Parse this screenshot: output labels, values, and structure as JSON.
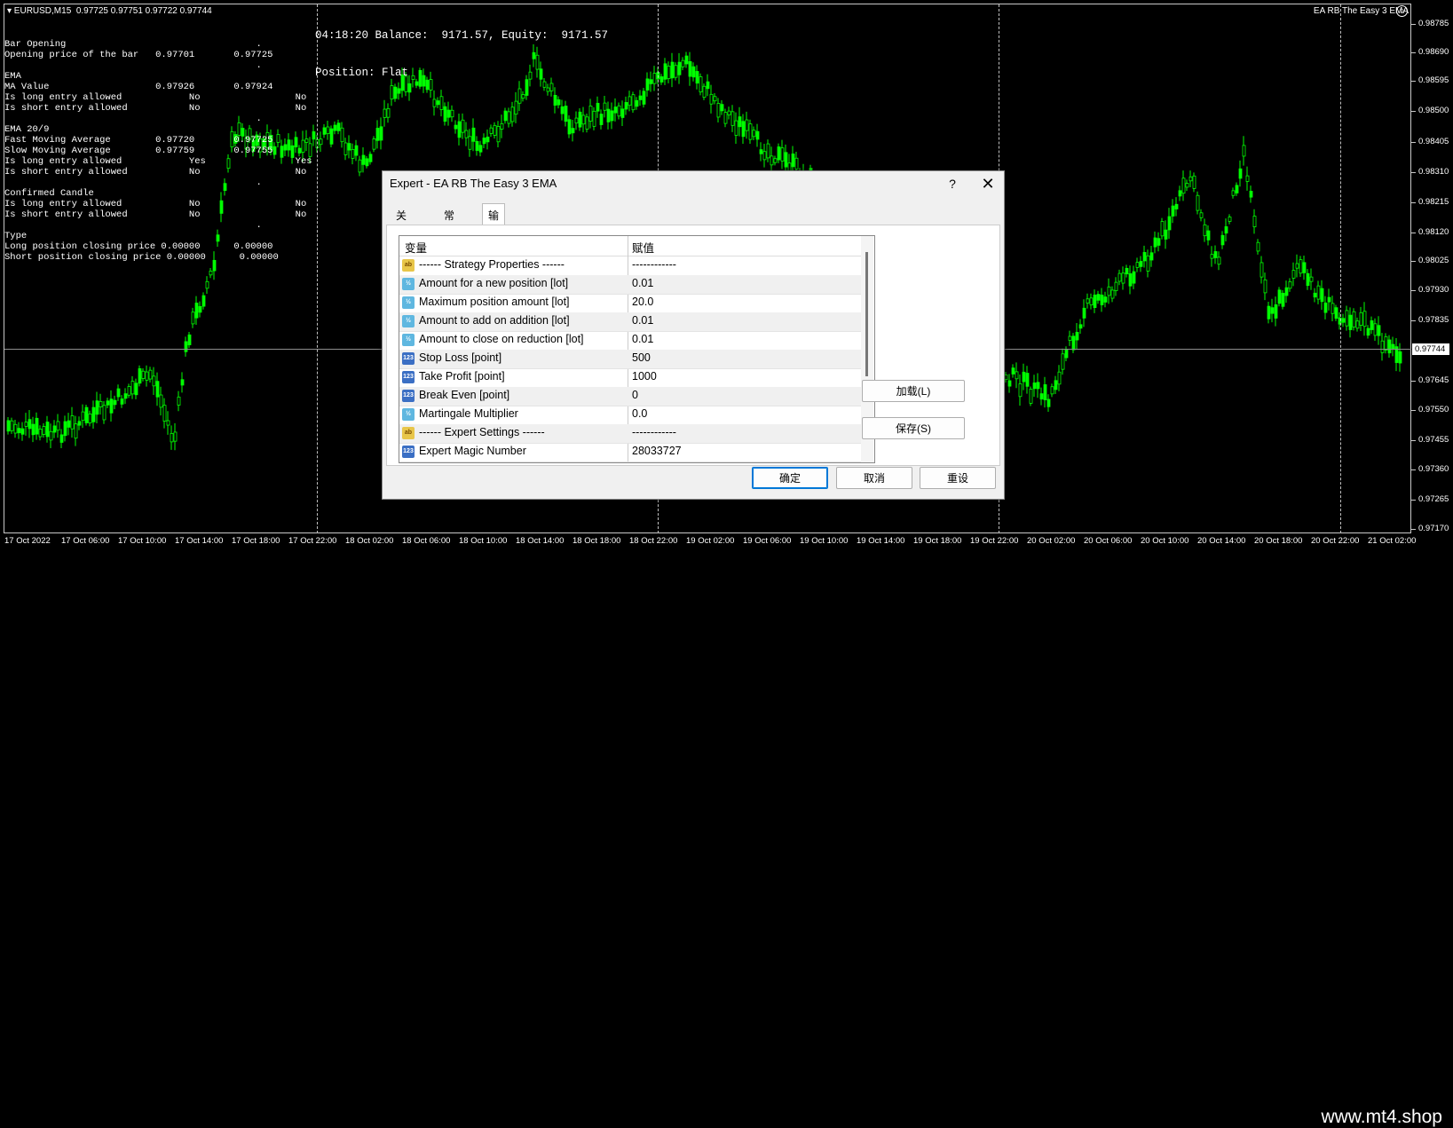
{
  "chart": {
    "symbol_info": "▾ EURUSD,M15  0.97725 0.97751 0.97722 0.97744",
    "balance_line": "04:18:20 Balance:  9171.57, Equity:  9171.57",
    "position_line": "Position: Flat",
    "ea_name": "EA RB The Easy 3 EMA",
    "current_price": "0.97744",
    "price_labels": [
      "0.98785",
      "0.98690",
      "0.98595",
      "0.98500",
      "0.98405",
      "0.98310",
      "0.98215",
      "0.98120",
      "0.98025",
      "0.97930",
      "0.97835",
      "0.97645",
      "0.97550",
      "0.97455",
      "0.97360",
      "0.97265",
      "0.97170"
    ],
    "time_labels": [
      "17 Oct 2022",
      "17 Oct 06:00",
      "17 Oct 10:00",
      "17 Oct 14:00",
      "17 Oct 18:00",
      "17 Oct 22:00",
      "18 Oct 02:00",
      "18 Oct 06:00",
      "18 Oct 10:00",
      "18 Oct 14:00",
      "18 Oct 18:00",
      "18 Oct 22:00",
      "19 Oct 02:00",
      "19 Oct 06:00",
      "19 Oct 10:00",
      "19 Oct 14:00",
      "19 Oct 18:00",
      "19 Oct 22:00",
      "20 Oct 02:00",
      "20 Oct 06:00",
      "20 Oct 10:00",
      "20 Oct 14:00",
      "20 Oct 18:00",
      "20 Oct 22:00",
      "21 Oct 02:00"
    ],
    "candle_color": "#00ff00",
    "info_lines": [
      "Bar Opening                                  .",
      "Opening price of the bar   0.97701       0.97725",
      "                                             .",
      "EMA",
      "MA Value                   0.97926       0.97924",
      "Is long entry allowed            No                 No",
      "Is short entry allowed           No                 No",
      "                                             .",
      "EMA 20/9",
      "Fast Moving Average        0.97720       0.97725",
      "Slow Moving Average        0.97759       0.97755",
      "Is long entry allowed            Yes                Yes",
      "Is short entry allowed           No                 No",
      "                                             .",
      "Confirmed Candle",
      "Is long entry allowed            No                 No",
      "Is short entry allowed           No                 No",
      "                                             .",
      "Type",
      "Long position closing price 0.00000      0.00000",
      "Short position closing price 0.00000      0.00000"
    ]
  },
  "dialog": {
    "title": "Expert - EA RB The Easy 3 EMA",
    "help_label": "?",
    "close_label": "✕",
    "tabs": [
      "关于",
      "常用",
      "输入参数"
    ],
    "active_tab": "输入参数",
    "columns": [
      "变量",
      "赋值"
    ],
    "params": [
      {
        "icon": "ab",
        "name": "------ Strategy Properties ------",
        "value": "------------"
      },
      {
        "icon": "v2",
        "name": "Amount for a new position [lot]",
        "value": "0.01"
      },
      {
        "icon": "v2",
        "name": "Maximum position amount [lot]",
        "value": "20.0"
      },
      {
        "icon": "v2",
        "name": "Amount to add on addition [lot]",
        "value": "0.01"
      },
      {
        "icon": "v2",
        "name": "Amount to close on reduction [lot]",
        "value": "0.01"
      },
      {
        "icon": "123",
        "name": "Stop Loss [point]",
        "value": "500"
      },
      {
        "icon": "123",
        "name": "Take Profit [point]",
        "value": "1000"
      },
      {
        "icon": "123",
        "name": "Break Even [point]",
        "value": "0"
      },
      {
        "icon": "v2",
        "name": "Martingale Multiplier",
        "value": "0.0"
      },
      {
        "icon": "ab",
        "name": "------ Expert Settings ------",
        "value": "------------"
      },
      {
        "icon": "123",
        "name": "Expert Magic Number",
        "value": "28033727"
      }
    ],
    "buttons": {
      "load": "加载(L)",
      "save": "保存(S)",
      "ok": "确定",
      "cancel": "取消",
      "reset": "重设"
    }
  },
  "watermark": "www.mt4.shop"
}
